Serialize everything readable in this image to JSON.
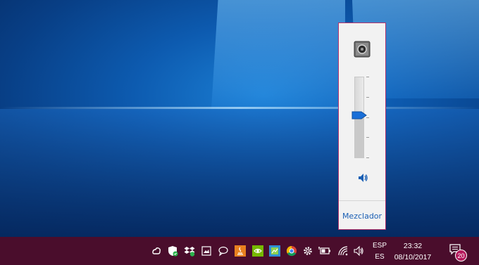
{
  "volume_flyout": {
    "device_icon": "speaker-device-icon",
    "volume_level_fraction": 0.55,
    "mute_icon": "speaker-volume-icon",
    "mixer_label": "Mezclador"
  },
  "taskbar": {
    "tray_icons": [
      "creative-cloud-icon",
      "windows-defender-icon",
      "dropbox-icon",
      "image-app-icon",
      "chat-bubble-icon",
      "java-icon",
      "nvidia-icon",
      "app-icon",
      "chrome-icon",
      "settings-gear-icon",
      "battery-icon",
      "wifi-icon",
      "volume-icon"
    ],
    "language_top": "ESP",
    "language_bottom": "ES",
    "time": "23:32",
    "date": "08/10/2017",
    "notification_count": "20"
  },
  "colors": {
    "taskbar": "#4a0d2c",
    "flyout_border": "#b3336b",
    "accent": "#1a5fb4",
    "badge": "#b5195c"
  }
}
